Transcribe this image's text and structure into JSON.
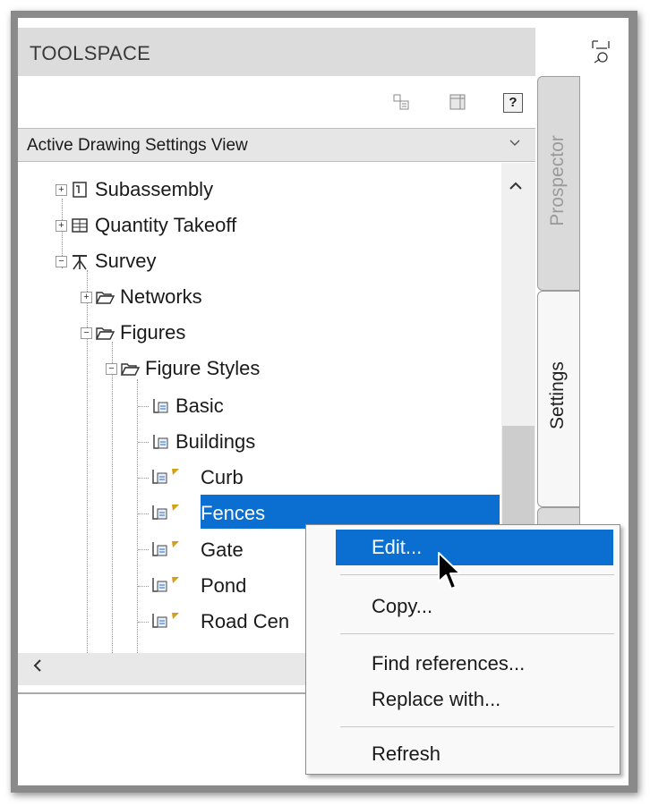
{
  "window": {
    "title": "TOOLSPACE"
  },
  "toolbar": {
    "help_label": "?"
  },
  "view_selector": {
    "value": "Active Drawing Settings View"
  },
  "tree": {
    "items": [
      {
        "label": "Subassembly",
        "expander": "+"
      },
      {
        "label": "Quantity Takeoff",
        "expander": "+"
      },
      {
        "label": "Survey",
        "expander": "−"
      },
      {
        "label": "Networks",
        "expander": "+"
      },
      {
        "label": "Figures",
        "expander": "−"
      },
      {
        "label": "Figure Styles",
        "expander": "−"
      },
      {
        "label": "Basic"
      },
      {
        "label": "Buildings"
      },
      {
        "label": "Curb"
      },
      {
        "label": "Fences",
        "selected": true
      },
      {
        "label": "Gate"
      },
      {
        "label": "Pond"
      },
      {
        "label": "Road Cen"
      }
    ]
  },
  "side_tabs": {
    "prospector": "Prospector",
    "settings": "Settings"
  },
  "context_menu": {
    "items": [
      {
        "label": "Edit...",
        "highlighted": true
      },
      {
        "label": "Copy..."
      },
      {
        "label": "Find references..."
      },
      {
        "label": "Replace with..."
      },
      {
        "label": "Refresh"
      }
    ]
  },
  "colors": {
    "selection": "#0a6fd0",
    "title_bar": "#dcdcdc",
    "frame": "#8a8a8a"
  },
  "icons": [
    "properties-icon",
    "layout-icon",
    "help-icon",
    "chevron-down-icon",
    "subassembly-icon",
    "quantity-takeoff-icon",
    "survey-icon",
    "folder-icon",
    "figure-style-icon",
    "scroll-up-icon",
    "scroll-left-icon",
    "dock-icon",
    "mouse-cursor-icon"
  ]
}
